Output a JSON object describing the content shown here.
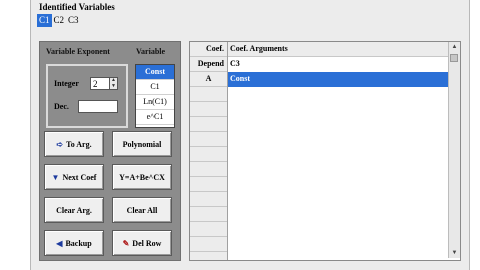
{
  "identified_variables": {
    "label": "Identified Variables",
    "tabs": [
      {
        "label": "C1",
        "selected": true
      },
      {
        "label": "C2",
        "selected": false
      },
      {
        "label": "C3",
        "selected": false
      }
    ]
  },
  "left_panel": {
    "variable_exponent_header": "Variable Exponent",
    "variable_header": "Variable",
    "integer_label": "Integer",
    "integer_value": "2",
    "dec_label": "Dec.",
    "dec_value": "",
    "variables": [
      "Const",
      "C1",
      "Ln(C1)",
      "e^C1"
    ],
    "selected_variable": "Const"
  },
  "buttons": {
    "to_arg": "To Arg.",
    "polynomial": "Polynomial",
    "next_coef": "Next Coef",
    "formula": "Y=A+Be^CX",
    "clear_arg": "Clear Arg.",
    "clear_all": "Clear All",
    "backup": "Backup",
    "del_row": "Del Row"
  },
  "grid": {
    "headers": {
      "coef": "Coef.",
      "args": "Coef. Arguments"
    },
    "rows": [
      {
        "coef": "Depend",
        "args": "C3",
        "selected": false
      },
      {
        "coef": "A",
        "args": "Const",
        "selected": true
      }
    ]
  },
  "colors": {
    "selection": "#2a6fd6",
    "panel": "#8c8c8c"
  }
}
